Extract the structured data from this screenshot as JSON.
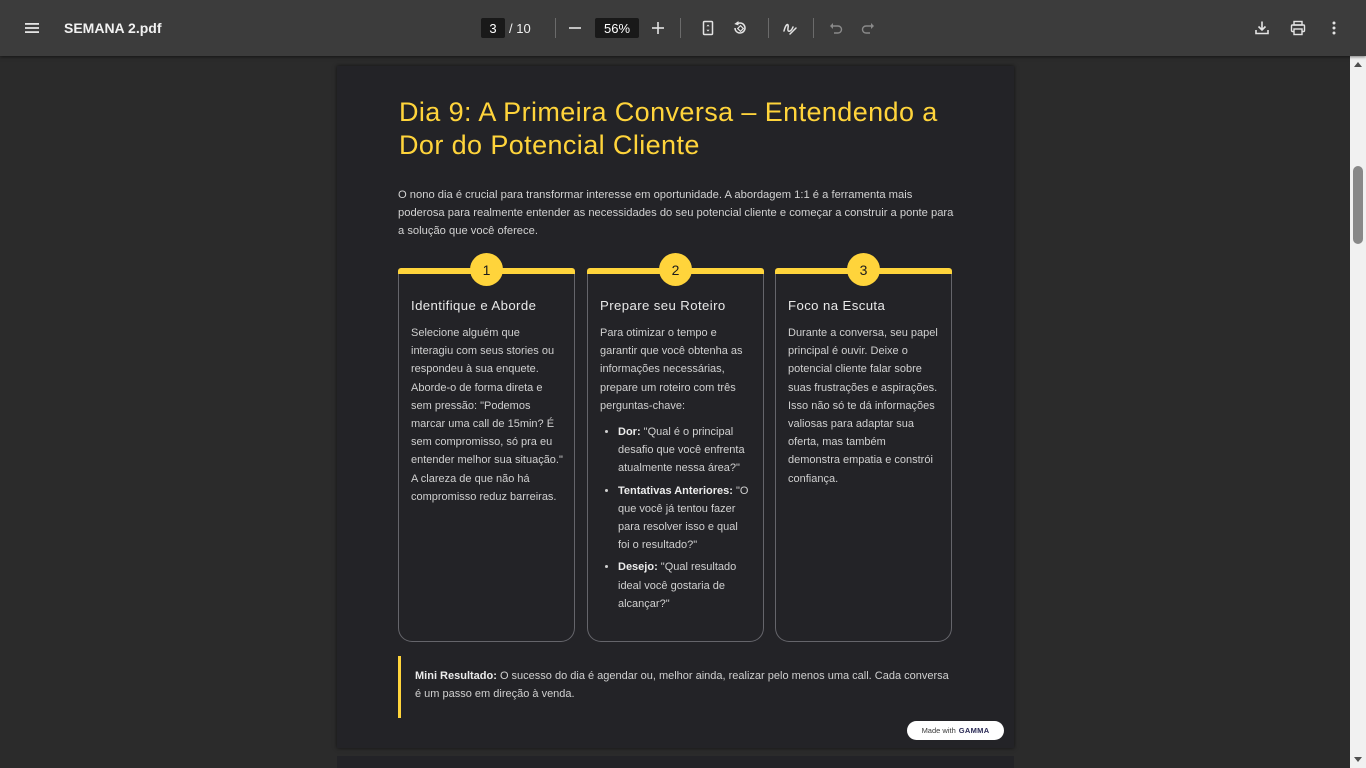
{
  "toolbar": {
    "menu_icon": "hamburger-menu-icon",
    "file_name": "SEMANA 2.pdf",
    "current_page": "3",
    "total_pages": "/ 10",
    "zoom": "56%",
    "icons": [
      "minus-icon",
      "plus-icon",
      "fit-page-icon",
      "rotate-icon",
      "draw-icon",
      "undo-icon",
      "redo-icon",
      "download-icon",
      "print-icon",
      "more-vertical-icon"
    ]
  },
  "slide": {
    "title": "Dia 9: A Primeira Conversa – Entendendo a Dor do Potencial Cliente",
    "intro": "O nono dia é crucial para transformar interesse em oportunidade. A abordagem 1:1 é a ferramenta mais poderosa para realmente entender as necessidades do seu potencial cliente e começar a construir a ponte para a solução que você oferece.",
    "cards": [
      {
        "number": "1",
        "title": "Identifique e Aborde",
        "body": "Selecione alguém que interagiu com seus stories ou respondeu à sua enquete. Aborde-o de forma direta e sem pressão: \"Podemos marcar uma call de 15min? É sem compromisso, só pra eu entender melhor sua situação.\" A clareza de que não há compromisso reduz barreiras."
      },
      {
        "number": "2",
        "title": "Prepare seu Roteiro",
        "body": "Para otimizar o tempo e garantir que você obtenha as informações necessárias, prepare um roteiro com três perguntas-chave:",
        "items": [
          {
            "label": "Dor:",
            "text": " \"Qual é o principal desafio que você enfrenta atualmente nessa área?\""
          },
          {
            "label": "Tentativas Anteriores:",
            "text": " \"O que você já tentou fazer para resolver isso e qual foi o resultado?\""
          },
          {
            "label": "Desejo:",
            "text": " \"Qual resultado ideal você gostaria de alcançar?\""
          }
        ]
      },
      {
        "number": "3",
        "title": "Foco na Escuta",
        "body": "Durante a conversa, seu papel principal é ouvir. Deixe o potencial cliente falar sobre suas frustrações e aspirações. Isso não só te dá informações valiosas para adaptar sua oferta, mas também demonstra empatia e constrói confiança."
      }
    ],
    "callout": {
      "label": "Mini Resultado:",
      "text": " O sucesso do dia é agendar ou, melhor ainda, realizar pelo menos uma call. Cada conversa é um passo em direção à venda."
    },
    "badge": {
      "prefix": "Made with",
      "brand": "GAMMA"
    }
  },
  "colors": {
    "accent": "#ffd43b",
    "page_bg": "#232327",
    "toolbar_bg": "#3c3c3c"
  }
}
